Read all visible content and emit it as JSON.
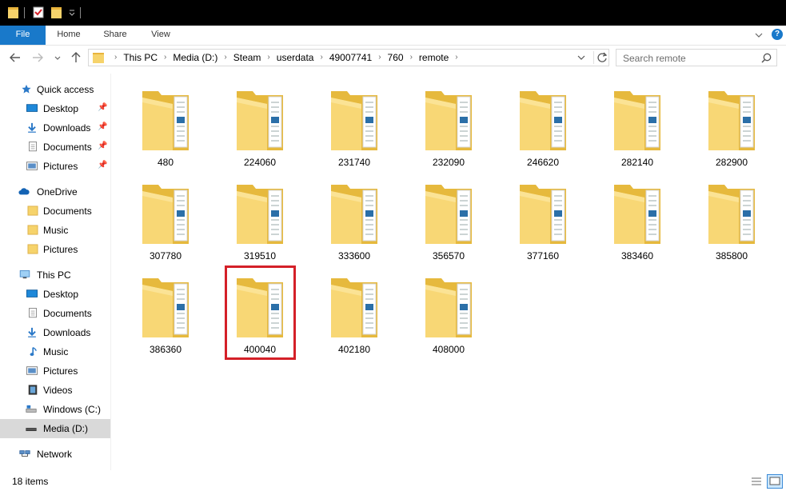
{
  "ribbon": {
    "tabs": [
      "File",
      "Home",
      "Share",
      "View"
    ]
  },
  "address": {
    "crumbs": [
      "This PC",
      "Media (D:)",
      "Steam",
      "userdata",
      "49007741",
      "760",
      "remote"
    ]
  },
  "search": {
    "placeholder": "Search remote"
  },
  "sidebar": {
    "items": [
      {
        "label": "Quick access",
        "icon": "star-icon"
      },
      {
        "label": "Desktop",
        "icon": "desktop-icon",
        "pinned": true
      },
      {
        "label": "Downloads",
        "icon": "download-icon",
        "pinned": true
      },
      {
        "label": "Documents",
        "icon": "documents-icon",
        "pinned": true
      },
      {
        "label": "Pictures",
        "icon": "pictures-icon",
        "pinned": true
      },
      {
        "label": "OneDrive",
        "icon": "cloud-icon"
      },
      {
        "label": "Documents",
        "icon": "folder-icon"
      },
      {
        "label": "Music",
        "icon": "folder-icon"
      },
      {
        "label": "Pictures",
        "icon": "folder-icon"
      },
      {
        "label": "This PC",
        "icon": "computer-icon"
      },
      {
        "label": "Desktop",
        "icon": "desktop-icon"
      },
      {
        "label": "Documents",
        "icon": "documents-icon"
      },
      {
        "label": "Downloads",
        "icon": "download-icon"
      },
      {
        "label": "Music",
        "icon": "music-icon"
      },
      {
        "label": "Pictures",
        "icon": "pictures-icon"
      },
      {
        "label": "Videos",
        "icon": "videos-icon"
      },
      {
        "label": "Windows (C:)",
        "icon": "drive-c-icon"
      },
      {
        "label": "Media (D:)",
        "icon": "drive-icon",
        "selected": true
      },
      {
        "label": "Network",
        "icon": "network-icon"
      }
    ]
  },
  "folders": [
    "480",
    "224060",
    "231740",
    "232090",
    "246620",
    "282140",
    "282900",
    "307780",
    "319510",
    "333600",
    "356570",
    "377160",
    "383460",
    "385800",
    "386360",
    "400040",
    "402180",
    "408000"
  ],
  "highlighted_folder": "400040",
  "status": {
    "item_count": "18 items"
  },
  "colors": {
    "accent": "#1979ca",
    "highlight_border": "#d42028",
    "folder": "#f6d36b"
  }
}
